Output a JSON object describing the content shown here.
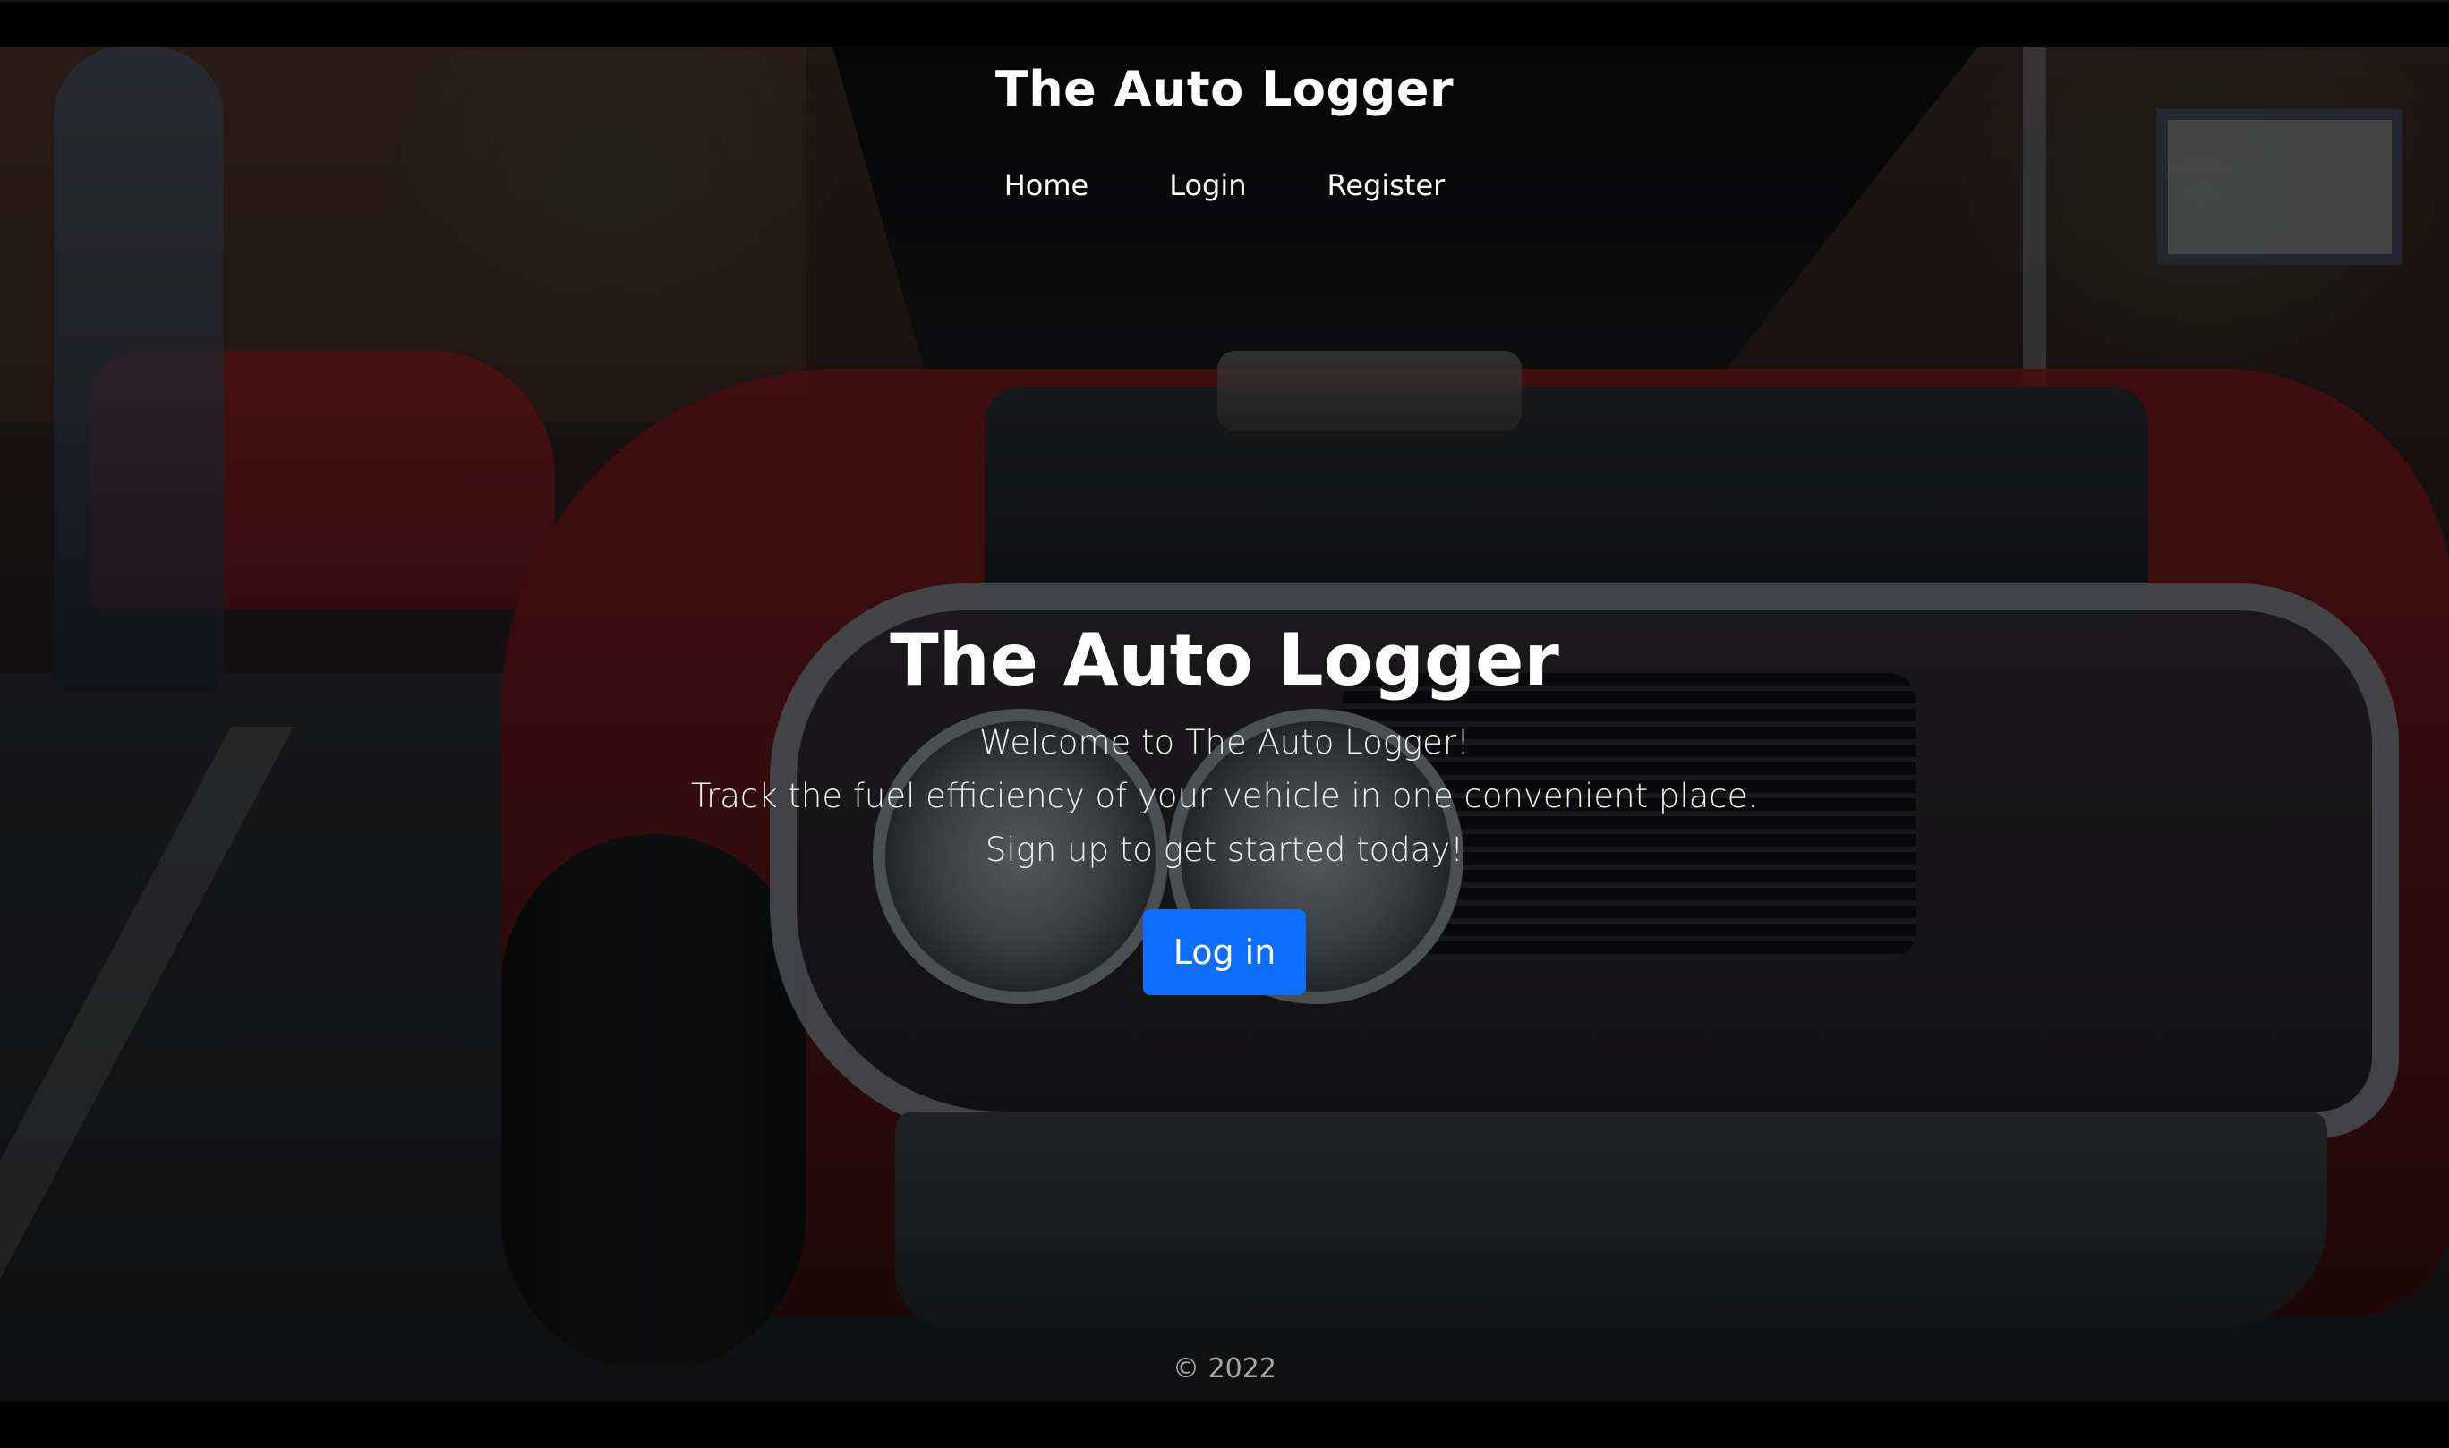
{
  "header": {
    "brand": "The Auto Logger"
  },
  "nav": {
    "items": [
      {
        "label": "Home"
      },
      {
        "label": "Login"
      },
      {
        "label": "Register"
      }
    ]
  },
  "hero": {
    "title": "The Auto Logger",
    "lines": [
      "Welcome to The Auto Logger!",
      "Track the fuel efficiency of your vehicle in one convenient place.",
      "Sign up to get started today!"
    ],
    "button_label": "Log in"
  },
  "footer": {
    "copyright": "© 2022"
  },
  "colors": {
    "primary_button": "#0d6efd",
    "text": "#ffffff",
    "footer_text": "#a6a6a6"
  }
}
